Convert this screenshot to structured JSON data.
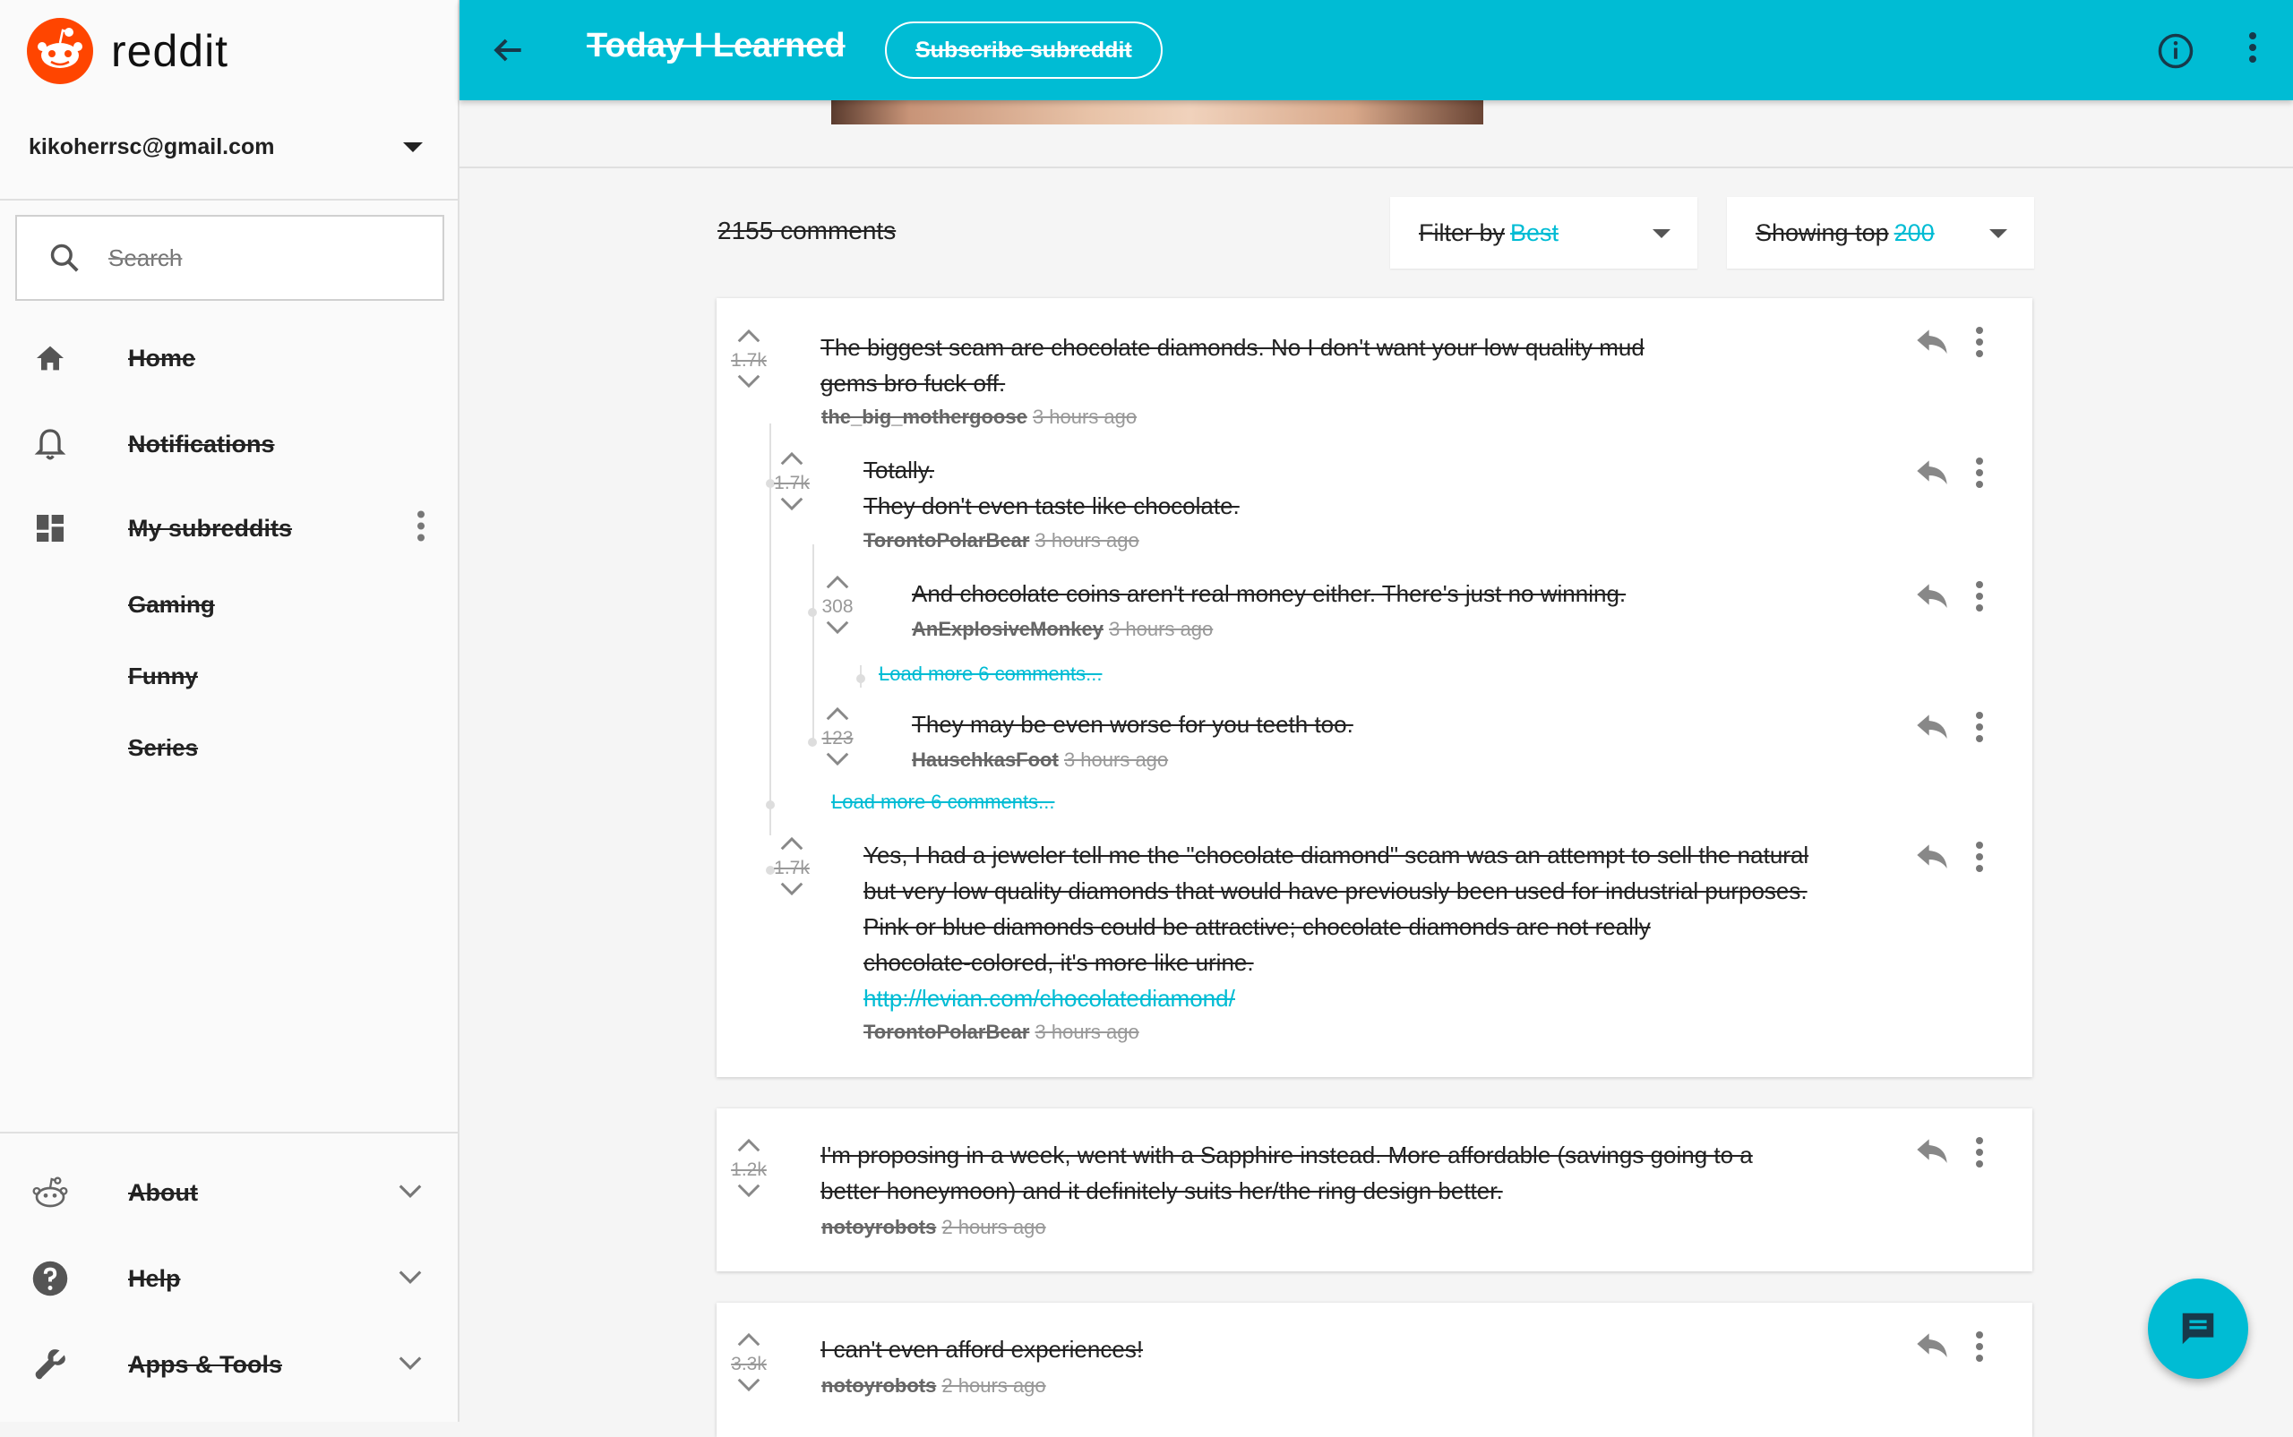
{
  "app": {
    "name": "reddit"
  },
  "account": {
    "email": "kikoherrsc@gmail.com"
  },
  "search": {
    "placeholder": "Search"
  },
  "nav": {
    "home": "Home",
    "notifications": "Notifications",
    "my_subreddits": "My subreddits",
    "subreddits": [
      "Gaming",
      "Funny",
      "Series"
    ],
    "about": "About",
    "help": "Help",
    "apps_tools": "Apps & Tools"
  },
  "header": {
    "title": "Today I Learned",
    "subscribe_label": "Subscribe subreddit"
  },
  "toolbar": {
    "comment_count": "2155 comments",
    "filter_label": "Filter by",
    "filter_value": "Best",
    "showing_label": "Showing top",
    "showing_value": "200"
  },
  "comments": {
    "c1": {
      "votes": "1.7k",
      "text_line1": "The biggest scam are chocolate diamonds. No I don't want your low quality mud",
      "text_line2": "gems bro fuck off.",
      "author": "the_big_mothergoose",
      "time": "3 hours ago"
    },
    "c1_1": {
      "votes": "1.7k",
      "text_line1": "Totally.",
      "text_line2": "They don't even taste like chocolate.",
      "author": "TorontoPolarBear",
      "time": "3 hours ago"
    },
    "c1_1_1": {
      "votes": "308",
      "text": "And chocolate coins aren't real money either. There's just no winning.",
      "author": "AnExplosiveMonkey",
      "time": "3 hours ago"
    },
    "load_more_inner": "Load more 6 comments...",
    "c1_1_2": {
      "votes": "123",
      "text": "They may be even worse for you teeth too.",
      "author": "HauschkasFoot",
      "time": "3 hours ago"
    },
    "load_more_outer": "Load more 6 comments...",
    "c1_2": {
      "votes": "1.7k",
      "text_line1": "Yes, I had a jeweler tell me the \"chocolate diamond\" scam was an attempt to sell the natural",
      "text_line2": "but very low quality diamonds that would have previously been used for industrial purposes.",
      "text_line3": "Pink or blue diamonds could be attractive; chocolate diamonds are not really",
      "text_line4": "chocolate-colored, it's more like urine.",
      "link": "http://levian.com/chocolatediamond/",
      "author": "TorontoPolarBear",
      "time": "3 hours ago"
    },
    "c2": {
      "votes": "1.2k",
      "text_line1": "I'm proposing in a week, went with a Sapphire instead. More affordable (savings going to a",
      "text_line2": "better honeymoon) and it definitely suits her/the ring design better.",
      "author": "notoyrobots",
      "time": "2 hours ago"
    },
    "c3": {
      "votes": "3.3k",
      "text": "I can't even afford experiences!",
      "author": "notoyrobots",
      "time": "2 hours ago"
    }
  },
  "colors": {
    "accent": "#00bcd4",
    "brand": "#ff4500"
  }
}
